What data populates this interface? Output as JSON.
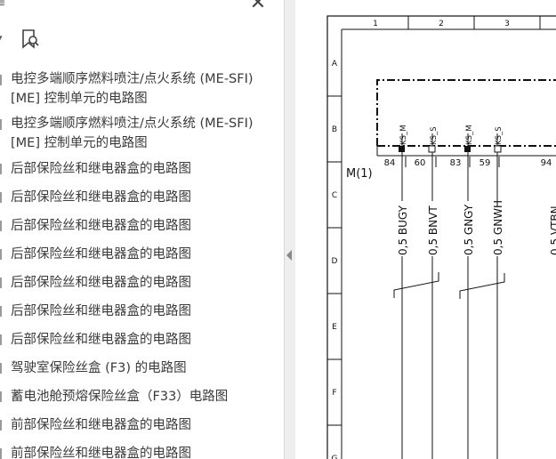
{
  "panel": {
    "top_glyph": "≡",
    "close_glyph": "✕",
    "items": [
      {
        "line1": "电控多端顺序燃料喷注/点火系统 (ME-SFI)",
        "line2": "[ME] 控制单元的电路图"
      },
      {
        "line1": "电控多端顺序燃料喷注/点火系统 (ME-SFI)",
        "line2": "[ME] 控制单元的电路图"
      },
      {
        "line1": "后部保险丝和继电器盒的电路图"
      },
      {
        "line1": "后部保险丝和继电器盒的电路图"
      },
      {
        "line1": "后部保险丝和继电器盒的电路图"
      },
      {
        "line1": "后部保险丝和继电器盒的电路图"
      },
      {
        "line1": "后部保险丝和继电器盒的电路图"
      },
      {
        "line1": "后部保险丝和继电器盒的电路图"
      },
      {
        "line1": "后部保险丝和继电器盒的电路图"
      },
      {
        "line1": "驾驶室保险丝盒 (F3) 的电路图"
      },
      {
        "line1": "蓄电池舱预熔保险丝盒（F33）电路图"
      },
      {
        "line1": "前部保险丝和继电器盒的电路图"
      },
      {
        "line1": "前部保险丝和继电器盒的电路图"
      }
    ]
  },
  "diagram": {
    "columns": [
      "1",
      "2",
      "3"
    ],
    "rows": [
      "A",
      "B",
      "C",
      "D",
      "E",
      "F",
      "G"
    ],
    "pin_labels": [
      "KS_M",
      "KS_S",
      "KS_M",
      "KS_S"
    ],
    "pin_numbers": [
      "84",
      "60",
      "83",
      "59",
      "94"
    ],
    "connector": "M(1)",
    "wires": [
      "0,5 BUGY",
      "0,5 BNVT",
      "0,5 GNGY",
      "0,5 GNWH"
    ]
  }
}
